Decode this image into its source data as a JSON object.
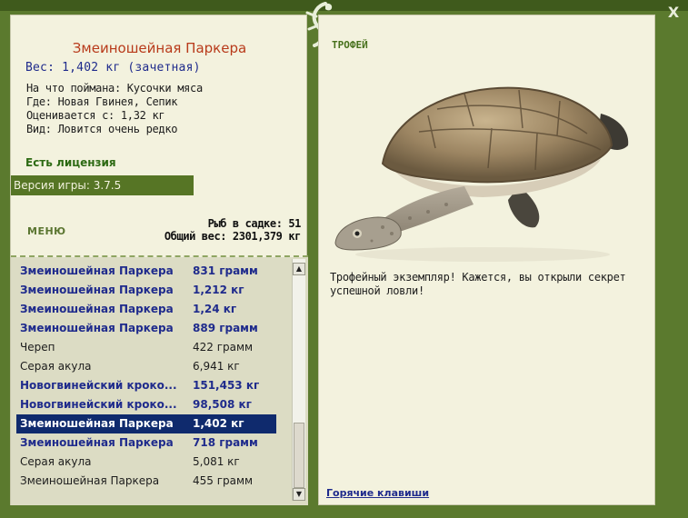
{
  "window": {
    "close_label": "X"
  },
  "left": {
    "fish_title": "Змеиношейная Паркера",
    "fish_weight": "Вес: 1,402 кг (зачетная)",
    "info_lines": [
      "На что поймана: Кусочки мяса",
      "Где: Новая Гвинея, Сепик",
      "Оценивается с: 1,32 кг",
      "Вид: Ловится очень редко"
    ],
    "license": "Есть лицензия",
    "version": "Версия игры: 3.7.5",
    "menu": "МЕНЮ",
    "stats": {
      "fish_in_keepnet": "Рыб в садке: 51",
      "total_weight": "Общий вес: 2301,379 кг"
    },
    "scroll_up": "▲",
    "scroll_down": "▼"
  },
  "catch_list": [
    {
      "name": "Змеиношейная Паркера",
      "weight": "831 грамм",
      "style": "trophy"
    },
    {
      "name": "Змеиношейная Паркера",
      "weight": "1,212 кг",
      "style": "trophy"
    },
    {
      "name": "Змеиношейная Паркера",
      "weight": "1,24 кг",
      "style": "trophy"
    },
    {
      "name": "Змеиношейная Паркера",
      "weight": "889 грамм",
      "style": "trophy"
    },
    {
      "name": "Череп",
      "weight": "422 грамм",
      "style": "normal"
    },
    {
      "name": "Серая акула",
      "weight": "6,941 кг",
      "style": "normal"
    },
    {
      "name": "Новогвинейский кроко...",
      "weight": "151,453 кг",
      "style": "trophy"
    },
    {
      "name": "Новогвинейский кроко...",
      "weight": "98,508 кг",
      "style": "trophy"
    },
    {
      "name": "Змеиношейная Паркера",
      "weight": "1,402 кг",
      "style": "selected"
    },
    {
      "name": "Змеиношейная Паркера",
      "weight": "718 грамм",
      "style": "trophy"
    },
    {
      "name": "Серая акула",
      "weight": "5,081 кг",
      "style": "normal"
    },
    {
      "name": "Змеиношейная Паркера",
      "weight": "455 грамм",
      "style": "normal"
    }
  ],
  "right": {
    "trophy_label": "ТРОФЕЙ",
    "trophy_message": "Трофейный экземпляр! Кажется, вы открыли секрет успешной ловли!",
    "hotkeys": "Горячие клавиши"
  },
  "colors": {
    "frame": "#5b7a2e",
    "panel": "#f3f2de",
    "trophy_text": "#1f2b8c",
    "selected_row": "#0f2a6d",
    "title_text": "#b83a1a"
  }
}
